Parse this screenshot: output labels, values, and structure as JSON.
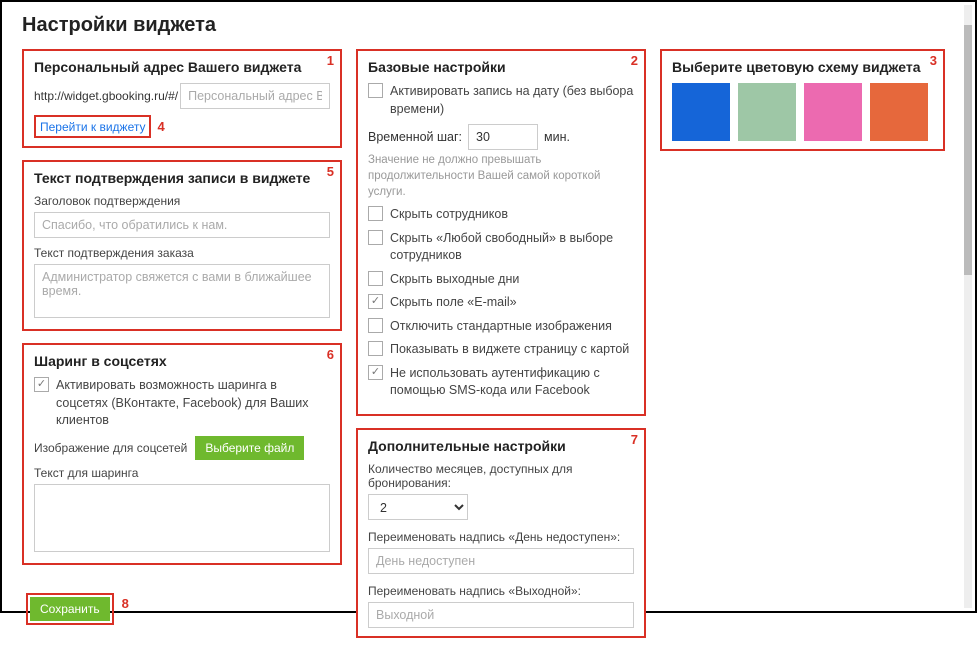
{
  "title": "Настройки виджета",
  "panel1": {
    "num": "1",
    "heading": "Персональный адрес Вашего виджета",
    "url_prefix": "http://widget.gbooking.ru/#/",
    "url_placeholder": "Персональный адрес Вашего виджета",
    "link_text": "Перейти к виджету",
    "link_num": "4"
  },
  "panel5": {
    "num": "5",
    "heading": "Текст подтверждения записи в виджете",
    "label1": "Заголовок подтверждения",
    "ph1": "Спасибо, что обратились к нам.",
    "label2": "Текст подтверждения заказа",
    "ph2": "Администратор свяжется с вами в ближайшее время."
  },
  "panel6": {
    "num": "6",
    "heading": "Шаринг в соцсетях",
    "opt1": "Активировать возможность шаринга в соцсетях (ВКонтакте, Facebook) для Ваших клиентов",
    "img_label": "Изображение для соцсетей",
    "choose_file": "Выберите файл",
    "share_text_label": "Текст для шаринга"
  },
  "panel2": {
    "num": "2",
    "heading": "Базовые настройки",
    "opt_date": "Активировать запись на дату (без выбора времени)",
    "step_label": "Временной шаг:",
    "step_value": "30",
    "step_unit": "мин.",
    "step_hint": "Значение не должно превышать продолжительности Вашей самой короткой услуги.",
    "opt_hide_staff": "Скрыть сотрудников",
    "opt_hide_any": "Скрыть «Любой свободный» в выборе сотрудников",
    "opt_hide_weekend": "Скрыть выходные дни",
    "opt_hide_email": "Скрыть поле «E-mail»",
    "opt_disable_img": "Отключить стандартные изображения",
    "opt_show_map": "Показывать в виджете страницу с картой",
    "opt_no_auth": "Не использовать аутентификацию с помощью SMS-кода или Facebook"
  },
  "panel7": {
    "num": "7",
    "heading": "Дополнительные настройки",
    "months_label": "Количество месяцев, доступных для бронирования:",
    "months_value": "2",
    "rename_day_label": "Переименовать надпись «День недоступен»:",
    "rename_day_ph": "День недоступен",
    "rename_weekend_label": "Переименовать надпись «Выходной»:",
    "rename_weekend_ph": "Выходной"
  },
  "panel3": {
    "num": "3",
    "heading": "Выберите цветовую схему виджета",
    "colors": [
      "#1565d8",
      "#9ec7a6",
      "#ec6ab0",
      "#e6683c"
    ]
  },
  "save": {
    "label": "Сохранить",
    "num": "8"
  }
}
